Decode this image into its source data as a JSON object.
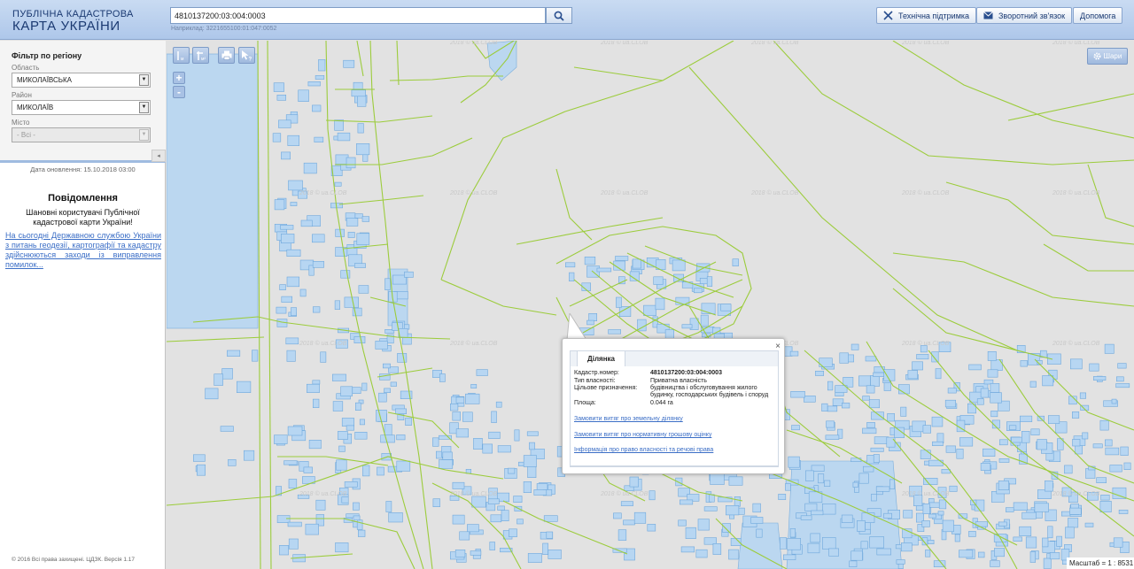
{
  "header": {
    "logo_line1": "ПУБЛІЧНА КАДАСТРОВА",
    "logo_line2": "КАРТА УКРАЇНИ",
    "search_value": "4810137200:03:004:0003",
    "search_example": "Наприклад: 3221655100:01:047:0052",
    "search_icon": "search-icon",
    "buttons": [
      {
        "label": "Технічна підтримка",
        "icon": "tools-icon"
      },
      {
        "label": "Зворотний зв'язок",
        "icon": "envelope-icon"
      },
      {
        "label": "Допомога",
        "icon": ""
      }
    ]
  },
  "sidebar": {
    "filter_title": "Фільтр по регіону",
    "oblast_label": "Область",
    "oblast_value": "МИКОЛАЇВСЬКА",
    "rayon_label": "Район",
    "rayon_value": "МИКОЛАЇВ",
    "misto_label": "Місто",
    "misto_value": "- Всі -",
    "collapse_glyph": "◂",
    "update_date": "Дата оновлення: 15.10.2018 03:00",
    "notice_title": "Повідомлення",
    "notice_text": "Шановні користувачі Публічної кадастрової карти України!",
    "notice_link": "На сьогодні Державною службою України з питань геодезії, картографії та кадастру здійснюються заходи із виправлення помилок...",
    "copyright": "© 2016 Всі права захищені. ЦДЗК. Версія 1.17"
  },
  "map": {
    "zoom_in": "+",
    "zoom_out": "-",
    "layers_label": "Шари",
    "scale_text": "Масштаб = 1 : 8531",
    "watermark": "2018 © ua.CLOB",
    "colors": {
      "parcel_line": "#9ccc3c",
      "building_fill": "#b7d6f2",
      "building_stroke": "#6fa8dc",
      "background": "#e2e2e2"
    }
  },
  "popup": {
    "tab_label": "Ділянка",
    "close_glyph": "×",
    "rows": [
      {
        "label": "Кадастр.номер:",
        "value": "4810137200:03:004:0003"
      },
      {
        "label": "Тип власності:",
        "value": "Приватна власність"
      },
      {
        "label": "Цільове призначення:",
        "value": "будівництва і обслуговування жилого будинку, господарських будівель і споруд"
      },
      {
        "label": "Площа:",
        "value": "0.044 га"
      }
    ],
    "links": [
      "Замовити витяг про земельну ділянку",
      "Замовити витяг про нормативну грошову оцінку",
      "Інформація про право власності та речові права"
    ]
  }
}
